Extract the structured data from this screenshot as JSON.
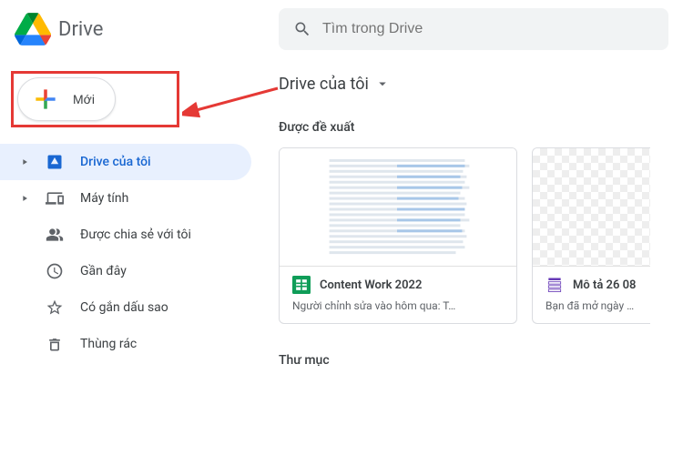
{
  "header": {
    "app_name": "Drive",
    "search_placeholder": "Tìm trong Drive"
  },
  "sidebar": {
    "new_label": "Mới",
    "items": [
      {
        "label": "Drive của tôi",
        "icon": "drive"
      },
      {
        "label": "Máy tính",
        "icon": "computers"
      },
      {
        "label": "Được chia sẻ với tôi",
        "icon": "shared"
      },
      {
        "label": "Gần đây",
        "icon": "recent"
      },
      {
        "label": "Có gắn dấu sao",
        "icon": "starred"
      },
      {
        "label": "Thùng rác",
        "icon": "trash"
      }
    ]
  },
  "main": {
    "breadcrumb": "Drive của tôi",
    "suggested_title": "Được đề xuất",
    "folders_title": "Thư mục",
    "cards": [
      {
        "title": "Content Work 2022",
        "subtitle": "Người chỉnh sửa vào hôm qua: T…",
        "file_type": "sheets"
      },
      {
        "title": "Mô tả 26 08",
        "subtitle": "Bạn đã mở ngày hô",
        "file_type": "forms"
      }
    ]
  }
}
